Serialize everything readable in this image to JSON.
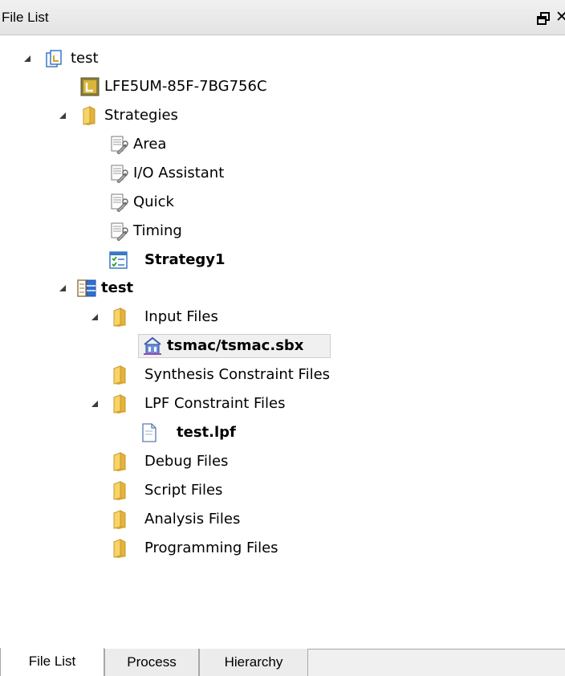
{
  "panel": {
    "title": "File List"
  },
  "tree": {
    "project_name": "test",
    "device": "LFE5UM-85F-7BG756C",
    "strategies_folder": "Strategies",
    "strategies": [
      "Area",
      "I/O Assistant",
      "Quick",
      "Timing"
    ],
    "active_strategy": "Strategy1",
    "implementation": "test",
    "input_files_folder": "Input Files",
    "input_file": "tsmac/tsmac.sbx",
    "synthesis_folder": "Synthesis Constraint Files",
    "lpf_folder": "LPF Constraint Files",
    "lpf_file": "test.lpf",
    "debug_folder": "Debug Files",
    "script_folder": "Script Files",
    "analysis_folder": "Analysis Files",
    "programming_folder": "Programming Files"
  },
  "tabs": [
    {
      "label": "File List",
      "active": true
    },
    {
      "label": "Process",
      "active": false
    },
    {
      "label": "Hierarchy",
      "active": false
    }
  ],
  "colors": {
    "folder": "#f2c94c",
    "arrow": "#3c3c3c",
    "selection": "#f0f0f0"
  }
}
